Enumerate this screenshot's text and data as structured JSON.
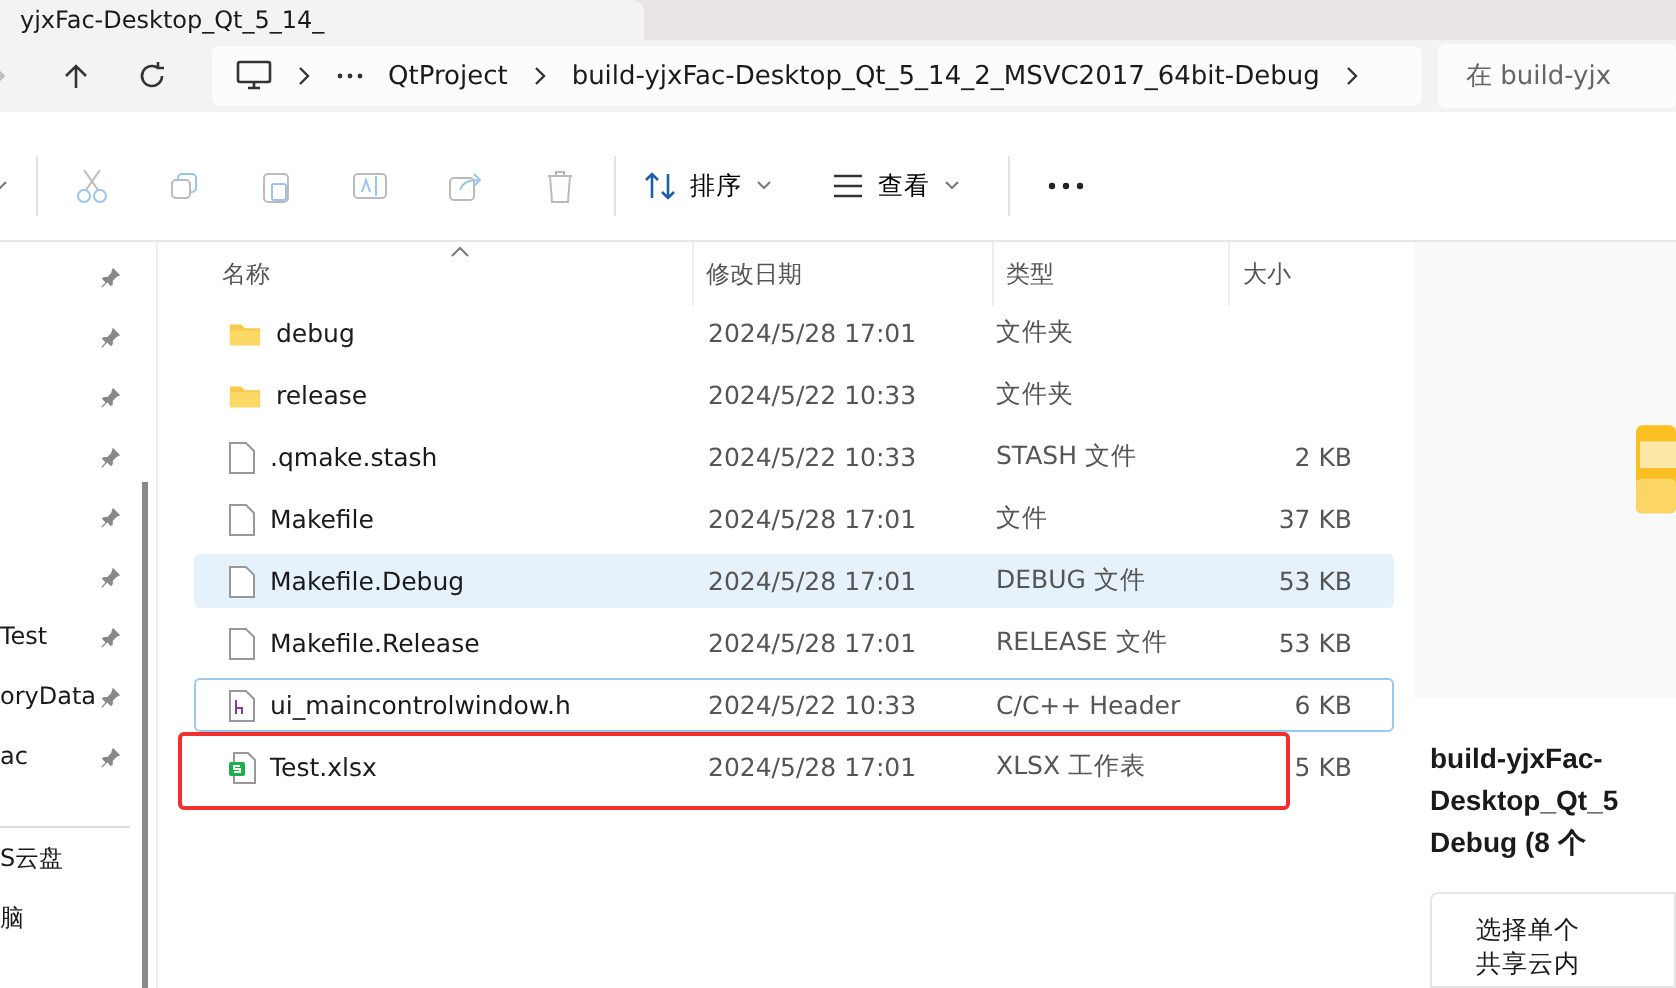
{
  "tab": {
    "title": "yjxFac-Desktop_Qt_5_14_"
  },
  "address": {
    "crumbs": [
      "QtProject",
      "build-yjxFac-Desktop_Qt_5_14_2_MSVC2017_64bit-Debug"
    ],
    "search_placeholder": "在 build-yjx"
  },
  "toolbar": {
    "sort": "排序",
    "view": "查看"
  },
  "sidebar": {
    "items": [
      {
        "pinned": true
      },
      {
        "pinned": true
      },
      {
        "pinned": true
      },
      {
        "pinned": true
      },
      {
        "pinned": true
      },
      {
        "pinned": true
      },
      {
        "label": "Test",
        "pinned": true
      },
      {
        "label": "oryData",
        "pinned": true
      },
      {
        "label": "ac",
        "pinned": true
      },
      {
        "label": "S云盘"
      },
      {
        "label": "脑"
      }
    ]
  },
  "table": {
    "columns": [
      "名称",
      "修改日期",
      "类型",
      "大小"
    ],
    "rows": [
      {
        "kind": "folder",
        "name": "debug",
        "date": "2024/5/28 17:01",
        "type": "文件夹",
        "selected": false,
        "focused": false,
        "marked": false
      },
      {
        "kind": "folder",
        "name": "release",
        "date": "2024/5/22 10:33",
        "type": "文件夹",
        "selected": false,
        "focused": false,
        "marked": false
      },
      {
        "kind": "file",
        "name": ".qmake.stash",
        "date": "2024/5/22 10:33",
        "type": "STASH 文件",
        "size": "2 KB",
        "selected": false,
        "focused": false,
        "marked": false
      },
      {
        "kind": "file",
        "name": "Makefile",
        "date": "2024/5/28 17:01",
        "type": "文件",
        "size": "37 KB",
        "selected": false,
        "focused": false,
        "marked": false
      },
      {
        "kind": "file",
        "name": "Makefile.Debug",
        "date": "2024/5/28 17:01",
        "type": "DEBUG 文件",
        "size": "53 KB",
        "selected": true,
        "focused": false,
        "marked": false
      },
      {
        "kind": "file",
        "name": "Makefile.Release",
        "date": "2024/5/28 17:01",
        "type": "RELEASE 文件",
        "size": "53 KB",
        "selected": false,
        "focused": false,
        "marked": false
      },
      {
        "kind": "header",
        "name": "ui_maincontrolwindow.h",
        "date": "2024/5/22 10:33",
        "type": "C/C++ Header",
        "size": "6 KB",
        "selected": false,
        "focused": true,
        "marked": false
      },
      {
        "kind": "sheet",
        "name": "Test.xlsx",
        "date": "2024/5/28 17:01",
        "type": "XLSX 工作表",
        "size": "5 KB",
        "selected": false,
        "focused": false,
        "marked": true
      }
    ]
  },
  "details": {
    "title_lines": [
      "build-yjxFac-",
      "Desktop_Qt_5",
      "Debug (8 个"
    ],
    "hint_lines": [
      "选择单个",
      "共享云内"
    ]
  }
}
